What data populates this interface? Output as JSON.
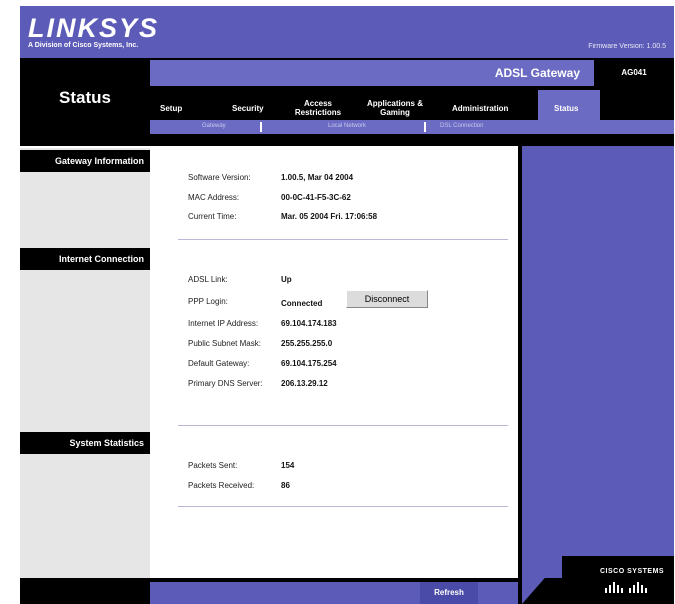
{
  "header": {
    "logo": "LINKSYS",
    "logo_sub": "A Division of Cisco Systems, Inc.",
    "firmware": "Firmware Version: 1.00.5"
  },
  "product": {
    "name": "ADSL Gateway",
    "model": "AG041"
  },
  "page_title": "Status",
  "tabs": [
    {
      "label": "Setup"
    },
    {
      "label": "Security"
    },
    {
      "label": "Access Restrictions"
    },
    {
      "label": "Applications & Gaming"
    },
    {
      "label": "Administration"
    },
    {
      "label": "Status"
    }
  ],
  "subnav": [
    {
      "label": "Gateway"
    },
    {
      "label": "Local Network"
    },
    {
      "label": "DSL Connection"
    }
  ],
  "sections": {
    "gateway": {
      "title": "Gateway Information",
      "rows": [
        {
          "label": "Software Version:",
          "value": "1.00.5, Mar 04 2004"
        },
        {
          "label": "MAC Address:",
          "value": "00-0C-41-F5-3C-62"
        },
        {
          "label": "Current Time:",
          "value": "Mar. 05 2004 Fri. 17:06:58"
        }
      ]
    },
    "internet": {
      "title": "Internet Connection",
      "rows": [
        {
          "label": "ADSL Link:",
          "value": "Up"
        },
        {
          "label": "PPP Login:",
          "value": "Connected"
        },
        {
          "label": "Internet IP Address:",
          "value": "69.104.174.183"
        },
        {
          "label": "Public Subnet Mask:",
          "value": "255.255.255.0"
        },
        {
          "label": "Default Gateway:",
          "value": "69.104.175.254"
        },
        {
          "label": "Primary DNS Server:",
          "value": "206.13.29.12"
        }
      ],
      "disconnect_label": "Disconnect"
    },
    "stats": {
      "title": "System Statistics",
      "rows": [
        {
          "label": "Packets Sent:",
          "value": "154"
        },
        {
          "label": "Packets Received:",
          "value": "86"
        }
      ]
    }
  },
  "footer": {
    "refresh_label": "Refresh",
    "cisco_label": "CISCO SYSTEMS"
  },
  "colors": {
    "brand_purple": "#5c5cb8",
    "tab_active": "#6b6bc4"
  }
}
